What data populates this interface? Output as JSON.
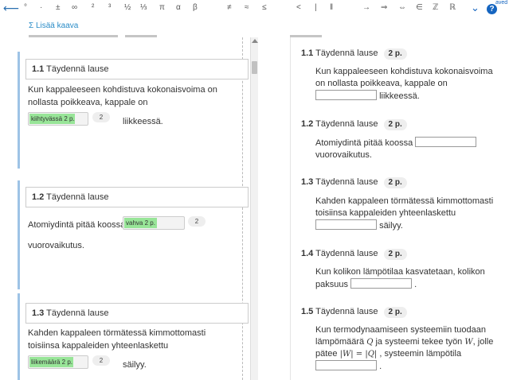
{
  "toolbar": {
    "symbols": [
      "°",
      "·",
      "±",
      "∞",
      "²",
      "³",
      "½",
      "⅓",
      "π",
      "α",
      "β",
      "≠",
      "≈",
      "≤",
      "<",
      "|",
      "‖",
      "→",
      "⇒",
      "⇔",
      "∈",
      "ℤ",
      "ℝ"
    ],
    "back_icon": "arrow-left-icon",
    "expand_icon": "chevron-down-icon",
    "help_label": "?",
    "saved_label": "aved"
  },
  "formula": {
    "add_label": "Σ Lisää kaava"
  },
  "editor": {
    "questions": [
      {
        "title_num": "1.1",
        "title": "Täydennä lause",
        "text_before": "Kun kappaleeseen kohdistuva kokonaisvoima on nollasta poikkeava, kappale on",
        "answer": "kiihtyvässä 2 p.",
        "score": "2",
        "text_after": "liikkeessä."
      },
      {
        "title_num": "1.2",
        "title": "Täydennä lause",
        "text_before": "Atomiydintä pitää koossa",
        "answer": "vahva 2 p.",
        "score": "2",
        "text_after": "vuorovaikutus."
      },
      {
        "title_num": "1.3",
        "title": "Täydennä lause",
        "text_before": "Kahden kappaleen törmätessä kimmottomasti toisiinsa kappaleiden yhteenlaskettu",
        "answer": "liikemäärä 2 p.",
        "score": "2",
        "text_after": "säilyy."
      }
    ]
  },
  "preview": {
    "questions": [
      {
        "num": "1.1",
        "title": "Täydennä lause",
        "points": "2 p.",
        "text_before": "Kun kappaleeseen kohdistuva kokonaisvoima on nollasta poikkeava, kappale on",
        "text_after": "liikkeessä."
      },
      {
        "num": "1.2",
        "title": "Täydennä lause",
        "points": "2 p.",
        "text_before": "Atomiydintä pitää koossa",
        "text_after": "vuorovaikutus."
      },
      {
        "num": "1.3",
        "title": "Täydennä lause",
        "points": "2 p.",
        "text_before": "Kahden kappaleen törmätessä kimmottomasti toisiinsa kappaleiden yhteenlaskettu",
        "text_after": "säilyy."
      },
      {
        "num": "1.4",
        "title": "Täydennä lause",
        "points": "2 p.",
        "text_before": "Kun kolikon lämpötilaa kasvatetaan, kolikon paksuus",
        "text_after": "."
      },
      {
        "num": "1.5",
        "title": "Täydennä lause",
        "points": "2 p.",
        "text_1": "Kun termodynaamiseen systeemiin tuodaan lämpömäärä",
        "math_q": "Q",
        "text_2": "ja systeemi tekee työn",
        "math_w": "W",
        "text_3": ", jolle pätee",
        "math_eq": "|W| = |Q|",
        "text_4": ", systeemin lämpötila",
        "text_after": "."
      }
    ]
  }
}
